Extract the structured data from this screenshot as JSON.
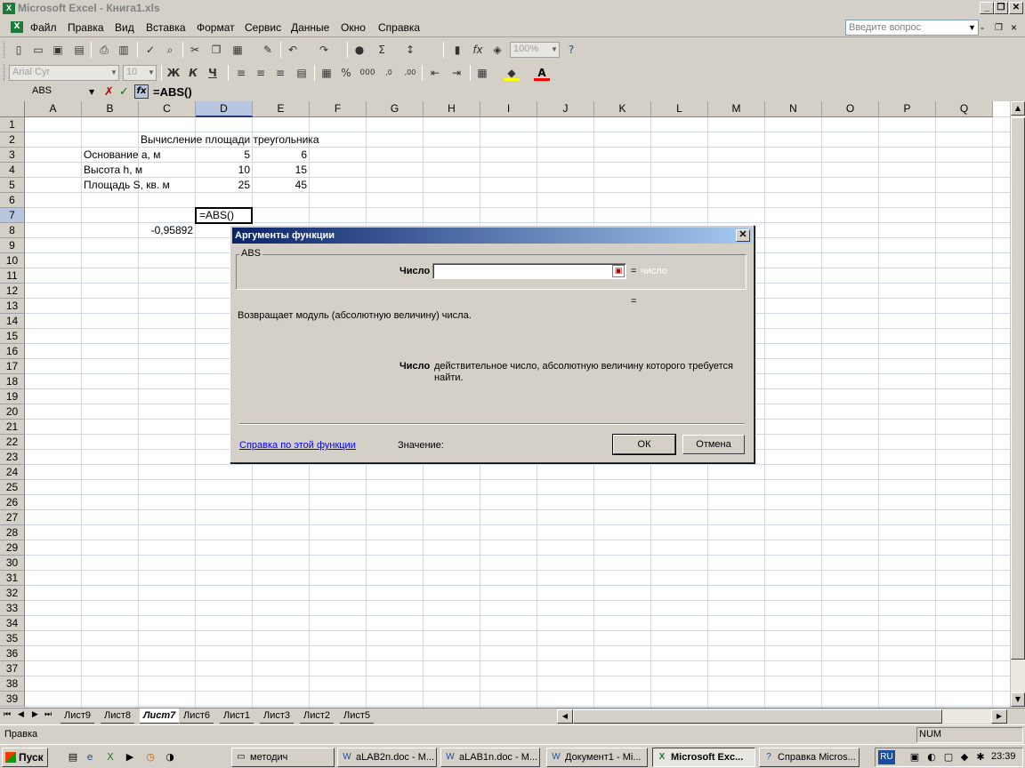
{
  "window": {
    "title": "Microsoft Excel - Книга1.xls",
    "app_icon": "excel-icon"
  },
  "menu": {
    "items": [
      "Файл",
      "Правка",
      "Вид",
      "Вставка",
      "Формат",
      "Сервис",
      "Данные",
      "Окно",
      "Справка"
    ],
    "help_placeholder": "Введите вопрос"
  },
  "toolbar": {
    "zoom": "100%",
    "font": "Arial Cyr",
    "size": "10",
    "bold": "Ж",
    "italic": "К",
    "underline": "Ч"
  },
  "formula_bar": {
    "name_box": "ABS",
    "formula": "=ABS()"
  },
  "columns": [
    "A",
    "B",
    "C",
    "D",
    "E",
    "F",
    "G",
    "H",
    "I",
    "J",
    "K",
    "L",
    "M",
    "N",
    "O",
    "P",
    "Q"
  ],
  "rows": [
    "1",
    "2",
    "3",
    "4",
    "5",
    "6",
    "7",
    "8",
    "9",
    "10",
    "11",
    "12",
    "13",
    "14",
    "15",
    "16",
    "17",
    "18",
    "19",
    "20",
    "21",
    "22",
    "23",
    "24",
    "25",
    "26",
    "27",
    "28",
    "29",
    "30",
    "31",
    "32",
    "33",
    "34",
    "35",
    "36",
    "37",
    "38",
    "39"
  ],
  "cells": {
    "c2": "Вычисление площади треугольника",
    "b3": "Основание a, м",
    "d3": "5",
    "e3": "6",
    "b4": "Высота h, м",
    "d4": "10",
    "e4": "15",
    "b5": "Площадь S, кв. м",
    "d5": "25",
    "e5": "45",
    "d7": "=ABS()",
    "c8": "-0,95892"
  },
  "sheets": [
    "Лист9",
    "Лист8",
    "Лист7",
    "Лист6",
    "Лист1",
    "Лист3",
    "Лист2",
    "Лист5"
  ],
  "active_sheet": "Лист7",
  "status": {
    "left": "Правка",
    "num": "NUM"
  },
  "taskbar": {
    "start": "Пуск",
    "buttons": [
      "методич",
      "aLAB2n.doc - M...",
      "aLAB1n.doc - M...",
      "Документ1 - Mi...",
      "Microsoft Exc...",
      "Справка Micros..."
    ],
    "lang": "RU",
    "time": "23:39"
  },
  "dialog": {
    "title": "Аргументы функции",
    "group": "ABS",
    "arg_label": "Число",
    "arg_eq": "=",
    "arg_hint": "число",
    "result_eq": "=",
    "description": "Возвращает модуль (абсолютную величину) числа.",
    "arg_desc_label": "Число",
    "arg_desc_line1": "действительное число, абсолютную величину которого требуется",
    "arg_desc_line2": "найти.",
    "help_link": "Справка по этой функции",
    "value_label": "Значение:",
    "ok": "ОК",
    "cancel": "Отмена"
  }
}
